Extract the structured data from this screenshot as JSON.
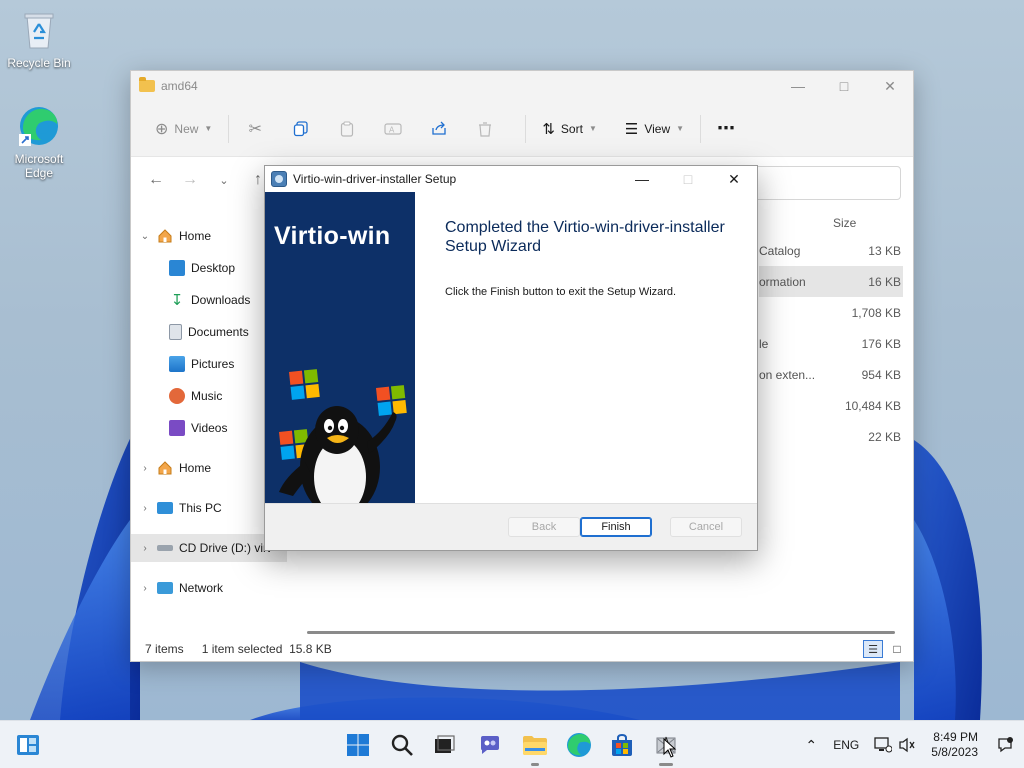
{
  "desktop": {
    "icons": [
      {
        "label": "Recycle Bin",
        "icon": "recycle-bin-icon"
      },
      {
        "label": "Microsoft Edge",
        "icon": "edge-icon"
      }
    ]
  },
  "explorer": {
    "title": "amd64",
    "toolbar": {
      "new_label": "New",
      "sort_label": "Sort",
      "view_label": "View",
      "more_label": "⋯"
    },
    "nav": [
      {
        "label": "Home",
        "icon": "home-icon",
        "expanded": true
      },
      {
        "label": "Desktop",
        "icon": "desktop-icon"
      },
      {
        "label": "Downloads",
        "icon": "downloads-icon"
      },
      {
        "label": "Documents",
        "icon": "documents-icon"
      },
      {
        "label": "Pictures",
        "icon": "pictures-icon"
      },
      {
        "label": "Music",
        "icon": "music-icon"
      },
      {
        "label": "Videos",
        "icon": "videos-icon"
      },
      {
        "label": "Home",
        "icon": "home-icon"
      },
      {
        "label": "This PC",
        "icon": "pc-icon"
      },
      {
        "label": "CD Drive (D:) virt",
        "icon": "cd-drive-icon",
        "selected": true
      },
      {
        "label": "Network",
        "icon": "network-icon"
      }
    ],
    "file_list": {
      "size_header": "Size",
      "rows": [
        {
          "name": "Catalog",
          "size": "13 KB"
        },
        {
          "name": "ormation",
          "size": "16 KB",
          "selected": true
        },
        {
          "name": "",
          "size": "1,708 KB"
        },
        {
          "name": "le",
          "size": "176 KB"
        },
        {
          "name": "on exten...",
          "size": "954 KB"
        },
        {
          "name": "",
          "size": "10,484 KB"
        },
        {
          "name": "",
          "size": "22 KB"
        }
      ]
    },
    "status": {
      "items_count": "7 items",
      "selection": "1 item selected",
      "selection_size": "15.8 KB"
    }
  },
  "setup": {
    "title": "Virtio-win-driver-installer Setup",
    "banner_text": "Virtio-win",
    "heading": "Completed the Virtio-win-driver-installer Setup Wizard",
    "description": "Click the Finish button to exit the Setup Wizard.",
    "buttons": {
      "back": "Back",
      "finish": "Finish",
      "cancel": "Cancel"
    }
  },
  "taskbar": {
    "apps": [
      "widgets-icon",
      "start-icon",
      "search-icon",
      "task-view-icon",
      "chat-icon",
      "file-explorer-icon",
      "edge-icon",
      "store-icon",
      "installer-icon"
    ],
    "language": "ENG",
    "time": "8:49 PM",
    "date": "5/8/2023"
  }
}
